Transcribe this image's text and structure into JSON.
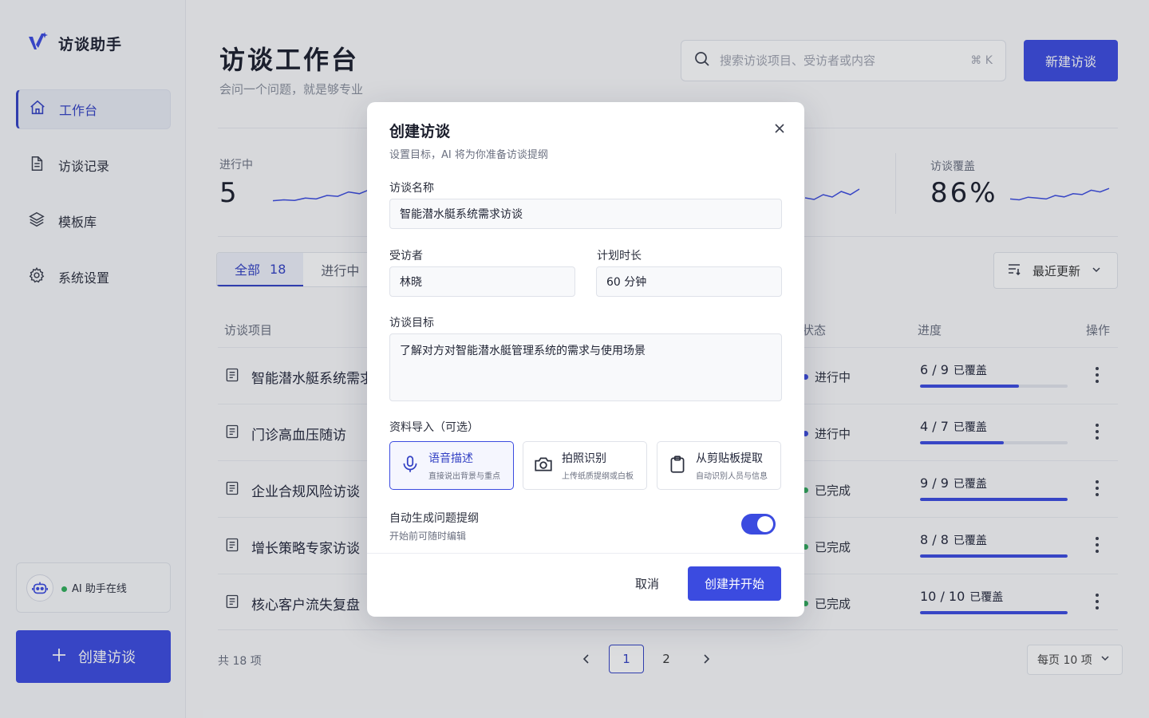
{
  "app": {
    "name": "访谈助手"
  },
  "sidebar": {
    "items": [
      {
        "label": "工作台",
        "icon": "home-icon",
        "active": true
      },
      {
        "label": "访谈记录",
        "icon": "document-icon",
        "active": false
      },
      {
        "label": "模板库",
        "icon": "layers-icon",
        "active": false
      },
      {
        "label": "系统设置",
        "icon": "gear-icon",
        "active": false
      }
    ],
    "ai_status": "AI 助手在线",
    "create_label": "创建访谈"
  },
  "header": {
    "title": "访谈工作台",
    "subtitle": "会问一个问题，就是够专业",
    "search_placeholder": "搜索访谈项目、受访者或内容",
    "shortcut": "⌘ K",
    "new_button": "新建访谈"
  },
  "stats": [
    {
      "label": "进行中",
      "value": "5",
      "trend": [
        0.2,
        0.25,
        0.22,
        0.35,
        0.3,
        0.5,
        0.45,
        0.7,
        0.6,
        0.85
      ]
    },
    {
      "label": "访谈覆盖",
      "value": "86%",
      "trend": [
        0.3,
        0.25,
        0.4,
        0.35,
        0.3,
        0.5,
        0.42,
        0.6,
        0.55,
        0.8,
        0.7,
        0.9
      ]
    }
  ],
  "stat_partial_trend": [
    0.3,
    0.2,
    0.5,
    0.35,
    0.7,
    0.5,
    0.85
  ],
  "tabs": [
    {
      "label": "全部",
      "count": "18",
      "active": true
    },
    {
      "label": "进行中",
      "count": "",
      "active": false
    }
  ],
  "sort": {
    "label": "最近更新"
  },
  "table": {
    "headers": {
      "project": "访谈项目",
      "status": "状态",
      "progress": "进度",
      "action": "操作"
    },
    "rows": [
      {
        "title": "智能潜水艇系统需求访谈",
        "status": "进行中",
        "status_color": "#3b4be0",
        "progress_text": "6 / 9",
        "covered": "已覆盖",
        "progress": 0.67
      },
      {
        "title": "门诊高血压随访",
        "status": "进行中",
        "status_color": "#3b4be0",
        "progress_text": "4 / 7",
        "covered": "已覆盖",
        "progress": 0.57
      },
      {
        "title": "企业合规风险访谈",
        "status": "已完成",
        "status_color": "#2fae5a",
        "progress_text": "9 / 9",
        "covered": "已覆盖",
        "progress": 1.0
      },
      {
        "title": "增长策略专家访谈",
        "status": "已完成",
        "status_color": "#2fae5a",
        "progress_text": "8 / 8",
        "covered": "已覆盖",
        "progress": 1.0
      },
      {
        "title": "核心客户流失复盘",
        "status": "已完成",
        "status_color": "#2fae5a",
        "progress_text": "10 / 10",
        "covered": "已覆盖",
        "progress": 1.0
      }
    ]
  },
  "pagination": {
    "total": "共 18 项",
    "pages": [
      "1",
      "2"
    ],
    "current": "1",
    "page_size": "每页  10 项"
  },
  "modal": {
    "title": "创建访谈",
    "subtitle": "设置目标，AI 将为你准备访谈提纲",
    "name_label": "访谈名称",
    "name_value": "智能潜水艇系统需求访谈",
    "interviewee_label": "受访者",
    "interviewee_value": "林晓",
    "duration_label": "计划时长",
    "duration_value": "60  分钟",
    "goal_label": "访谈目标",
    "goal_value": "了解对方对智能潜水艇管理系统的需求与使用场景",
    "import_label": "资料导入（可选）",
    "import_options": [
      {
        "title": "语音描述",
        "desc": "直接说出背景与重点",
        "icon": "microphone-icon",
        "selected": true
      },
      {
        "title": "拍照识别",
        "desc": "上传纸质提纲或白板",
        "icon": "camera-icon",
        "selected": false
      },
      {
        "title": "从剪贴板提取",
        "desc": "自动识别人员与信息",
        "icon": "clipboard-icon",
        "selected": false
      }
    ],
    "auto_label": "自动生成问题提纲",
    "auto_sub": "开始前可随时编辑",
    "auto_enabled": true,
    "cancel": "取消",
    "submit": "创建并开始"
  },
  "colors": {
    "accent": "#3b4be0",
    "success": "#2fae5a"
  }
}
